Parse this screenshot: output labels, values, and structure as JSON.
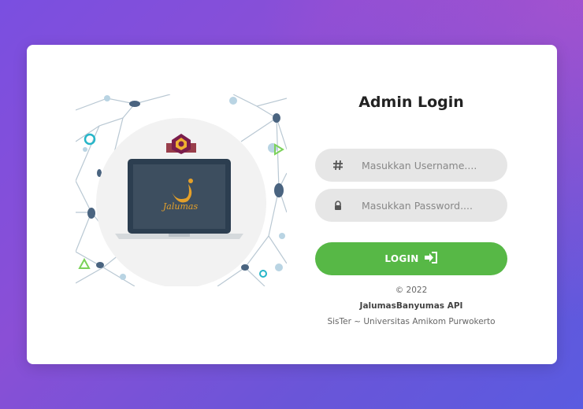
{
  "login_form": {
    "title": "Admin Login",
    "username": {
      "placeholder": "Masukkan Username....",
      "value": ""
    },
    "password": {
      "placeholder": "Masukkan Password....",
      "value": ""
    },
    "login_label": "LOGIN"
  },
  "illustration": {
    "laptop_logo_text": "Jalumas"
  },
  "footer": {
    "copyright": "© 2022",
    "app_name": "JalumasBanyumas API",
    "credit": "SisTer ~ Universitas Amikom Purwokerto"
  },
  "colors": {
    "accent": "#57b846",
    "background_start": "#7a4fe0",
    "background_end": "#5a5be0",
    "field_bg": "#e6e6e6"
  },
  "icons": {
    "username": "hash-icon",
    "password": "lock-icon",
    "login": "sign-in-icon"
  }
}
